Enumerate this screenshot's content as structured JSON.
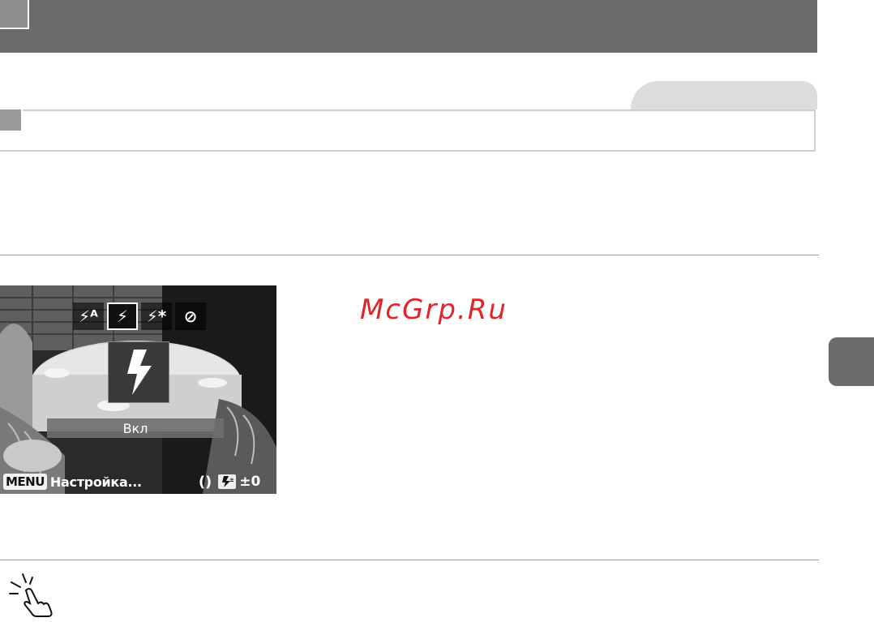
{
  "watermark": "McGrp.Ru",
  "camera_screen": {
    "flash_modes": [
      {
        "icon": "flash-auto-icon",
        "glyph": "⚡ᴬ"
      },
      {
        "icon": "flash-on-icon",
        "glyph": "⚡"
      },
      {
        "icon": "flash-slow-sync-icon",
        "glyph": "⚡*"
      },
      {
        "icon": "flash-off-icon",
        "glyph": "⊘"
      }
    ],
    "selected_mode_index": 1,
    "status_text": "Вкл",
    "menu_button": "MENU",
    "menu_label": "Настройка...",
    "flash_comp_value": "±0"
  },
  "colors": {
    "title_bar": "#6b6b6d",
    "watermark": "#e2242a"
  }
}
